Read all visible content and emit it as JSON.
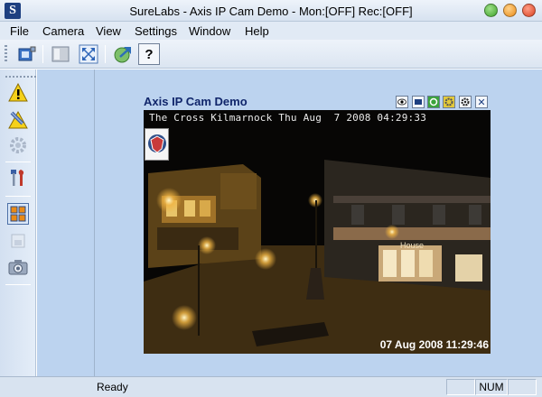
{
  "window": {
    "title": "SureLabs - Axis IP Cam Demo - Mon:[OFF]  Rec:[OFF]",
    "app_icon_letter": "S"
  },
  "menu": {
    "items": [
      {
        "label": "File"
      },
      {
        "label": "Camera"
      },
      {
        "label": "View"
      },
      {
        "label": "Settings"
      },
      {
        "label": "Window"
      },
      {
        "label": "Help"
      }
    ]
  },
  "toolbar": {
    "help_label": "?"
  },
  "camera_window": {
    "title": "Axis IP Cam Demo",
    "overlay_top": "The Cross Kilmarnock Thu Aug  7 2008 04:29:33",
    "overlay_bottom": "07 Aug 2008 11:29:46",
    "shop_sign": "House"
  },
  "status": {
    "text": "Ready",
    "num_label": "NUM"
  },
  "colors": {
    "workspace": "#bcd3ef",
    "title_text": "#10256a",
    "warning": "#f5d11a"
  }
}
